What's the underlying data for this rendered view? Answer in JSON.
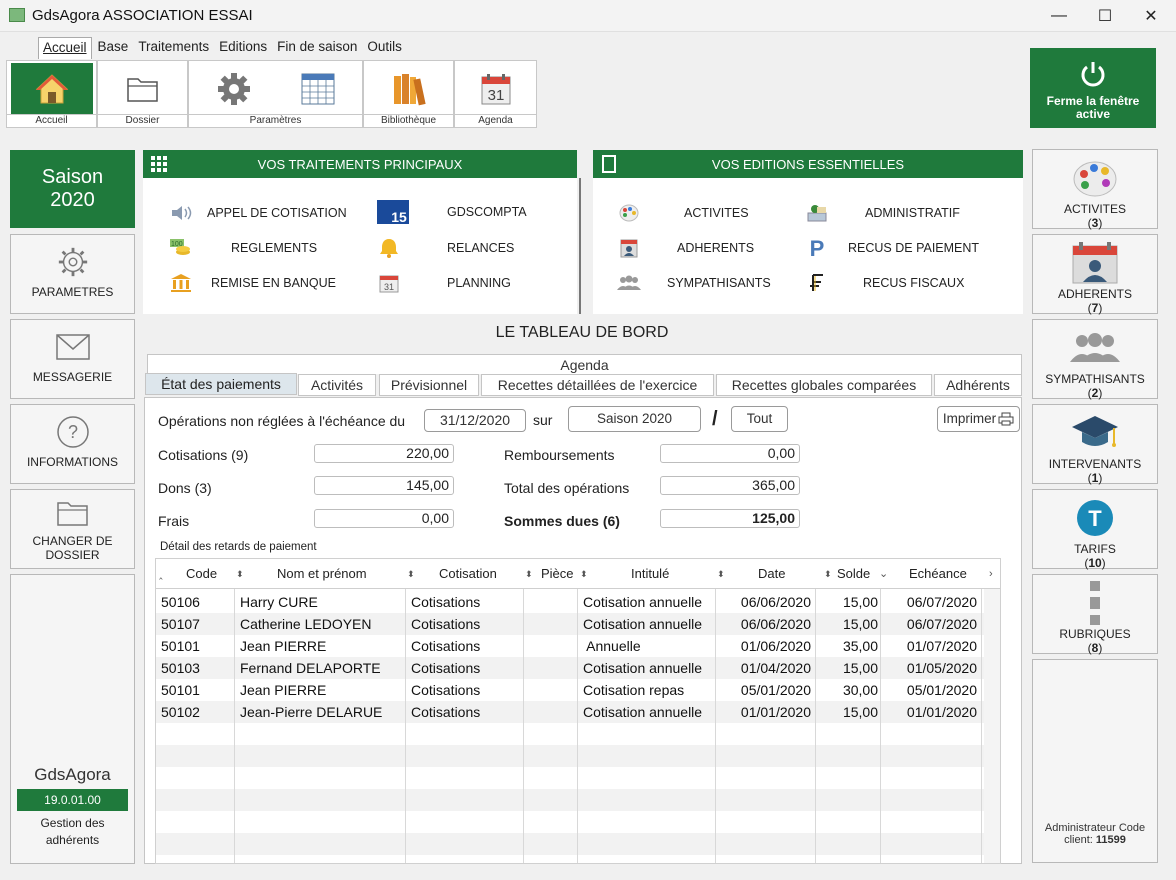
{
  "window": {
    "title": "GdsAgora ASSOCIATION ESSAI",
    "controls": {
      "minimize": "—",
      "maximize": "☐",
      "close": "✕"
    }
  },
  "menu": [
    "Accueil",
    "Base",
    "Traitements",
    "Editions",
    "Fin de saison",
    "Outils"
  ],
  "ribbon": {
    "groups": {
      "accueil": "Accueil",
      "dossier": "Dossier",
      "parametres": "Paramètres",
      "bibliotheque": "Bibliothèque",
      "agenda": "Agenda"
    },
    "calendar_day": "31",
    "close_active": "Ferme la fenêtre active"
  },
  "left": {
    "saison_label": "Saison",
    "saison_year": "2020",
    "parametres": "PARAMETRES",
    "messagerie": "MESSAGERIE",
    "informations": "INFORMATIONS",
    "changer_1": "CHANGER DE",
    "changer_2": "DOSSIER",
    "app_name": "GdsAgora",
    "version": "19.0.01.00",
    "app_desc_1": "Gestion des",
    "app_desc_2": "adhérents"
  },
  "traitements": {
    "title": "VOS TRAITEMENTS PRINCIPAUX",
    "items": [
      "APPEL DE COTISATION",
      "REGLEMENTS",
      "REMISE EN BANQUE",
      "GDSCOMPTA",
      "RELANCES",
      "PLANNING"
    ],
    "compta_day": "15",
    "planning_day": "31"
  },
  "editions": {
    "title": "VOS EDITIONS  ESSENTIELLES",
    "items": [
      "ACTIVITES",
      "ADHERENTS",
      "SYMPATHISANTS",
      "ADMINISTRATIF",
      "RECUS DE PAIEMENT",
      "RECUS FISCAUX"
    ]
  },
  "dashboard": {
    "title": "LE TABLEAU DE BORD",
    "tabs_top": "Agenda",
    "tabs": [
      "État des paiements",
      "Activités",
      "Prévisionnel",
      "Recettes détaillées de l'exercice",
      "Recettes globales comparées",
      "Adhérents"
    ],
    "ops_label": "Opérations non réglées à l'échéance du",
    "ops_date": "31/12/2020",
    "sur": "sur",
    "saison_select": "Saison 2020",
    "slash": "/",
    "tout": "Tout",
    "imprimer": "Imprimer",
    "cotisations_label": "Cotisations (9)",
    "cotisations_value": "220,00",
    "dons_label": "Dons (3)",
    "dons_value": "145,00",
    "frais_label": "Frais",
    "frais_value": "0,00",
    "remb_label": "Remboursements",
    "remb_value": "0,00",
    "total_label": "Total des opérations",
    "total_value": "365,00",
    "dues_label": "Sommes dues (6)",
    "dues_value": "125,00",
    "detail_label": "Détail des retards de paiement"
  },
  "table": {
    "columns": [
      "Code",
      "Nom et prénom",
      "Cotisation",
      "Pièce",
      "Intitulé",
      "Date",
      "Solde",
      "Echéance"
    ],
    "rows": [
      [
        "50106",
        "Harry CURE",
        "Cotisations",
        "",
        "Cotisation annuelle",
        "06/06/2020",
        "15,00",
        "06/07/2020"
      ],
      [
        "50107",
        "Catherine LEDOYEN",
        "Cotisations",
        "",
        "Cotisation annuelle",
        "06/06/2020",
        "15,00",
        "06/07/2020"
      ],
      [
        "50101",
        "Jean PIERRE",
        "Cotisations",
        "",
        " Annuelle",
        "01/06/2020",
        "35,00",
        "01/07/2020"
      ],
      [
        "50103",
        "Fernand DELAPORTE",
        "Cotisations",
        "",
        "Cotisation annuelle",
        "01/04/2020",
        "15,00",
        "01/05/2020"
      ],
      [
        "50101",
        "Jean PIERRE",
        "Cotisations",
        "",
        "Cotisation repas",
        "05/01/2020",
        "30,00",
        "05/01/2020"
      ],
      [
        "50102",
        "Jean-Pierre DELARUE",
        "Cotisations",
        "",
        "Cotisation annuelle",
        "01/01/2020",
        "15,00",
        "01/01/2020"
      ]
    ]
  },
  "right": {
    "activites": "ACTIVITES",
    "activites_count": "3",
    "adherents": "ADHERENTS",
    "adherents_count": "7",
    "sympathisants": "SYMPATHISANTS",
    "sympathisants_count": "2",
    "intervenants": "INTERVENANTS",
    "intervenants_count": "1",
    "tarifs": "TARIFS",
    "tarifs_count": "10",
    "tarifs_letter": "T",
    "rubriques": "RUBRIQUES",
    "rubriques_count": "8",
    "admin_1": "Administrateur Code",
    "admin_2": "client:",
    "admin_code": "11599"
  },
  "colors": {
    "accent": "#1f7a3c",
    "tab_active": "#dde6ec"
  }
}
